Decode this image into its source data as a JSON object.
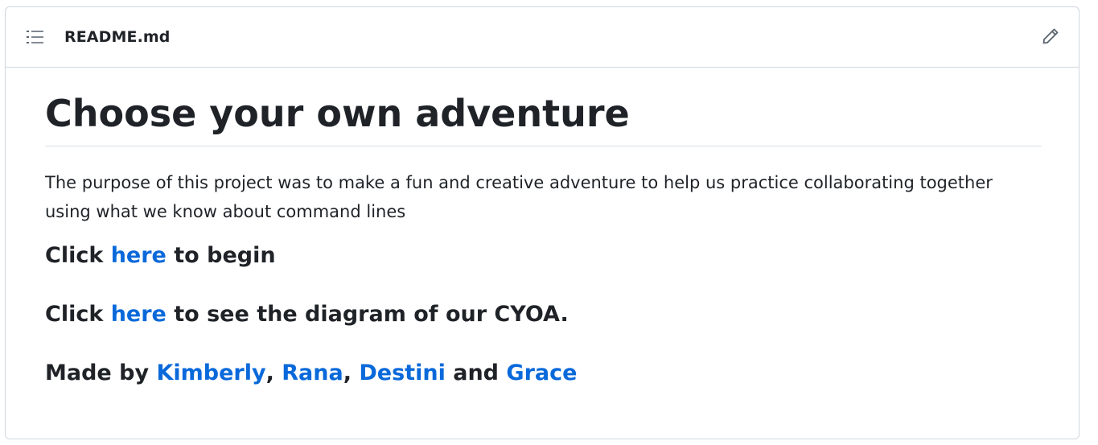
{
  "header": {
    "file_name": "README.md",
    "toc_icon": "list-unordered-icon",
    "edit_icon": "pencil-icon"
  },
  "content": {
    "title": "Choose your own adventure",
    "description": "The purpose of this project was to make a fun and creative adventure to help us practice collaborating together using what we know about command lines",
    "begin_line": {
      "prefix": "Click ",
      "link": "here",
      "suffix": " to begin"
    },
    "diagram_line": {
      "prefix": "Click ",
      "link": "here",
      "suffix": " to see the diagram of our CYOA."
    },
    "authors_line": {
      "prefix": "Made by ",
      "authors": [
        "Kimberly",
        "Rana",
        "Destini",
        "Grace"
      ],
      "sep1": ", ",
      "sep2": ", ",
      "sep3": " and "
    }
  },
  "colors": {
    "link": "#0969da",
    "text": "#1f2328",
    "border": "#d0d7de"
  }
}
